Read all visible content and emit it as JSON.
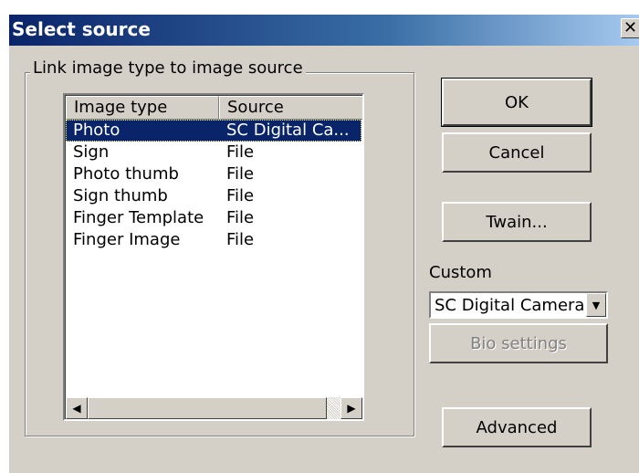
{
  "window": {
    "title": "Select source",
    "close_symbol": "✕"
  },
  "group": {
    "legend": "Link image type to image source"
  },
  "list": {
    "columns": [
      "Image type",
      "Source"
    ],
    "rows": [
      {
        "type": "Photo",
        "source": "SC Digital Ca...",
        "selected": true
      },
      {
        "type": "Sign",
        "source": "File"
      },
      {
        "type": "Photo thumb",
        "source": "File"
      },
      {
        "type": "Sign thumb",
        "source": "File"
      },
      {
        "type": "Finger Template",
        "source": "File"
      },
      {
        "type": "Finger Image",
        "source": "File"
      }
    ],
    "scroll_left_icon": "◀",
    "scroll_right_icon": "▶"
  },
  "buttons": {
    "ok": "OK",
    "cancel": "Cancel",
    "twain": "Twain...",
    "bio_settings": "Bio settings",
    "advanced": "Advanced"
  },
  "custom": {
    "label": "Custom",
    "selected_value": "SC Digital Camera",
    "dropdown_icon": "▼"
  },
  "colors": {
    "face": "#d4d0c8",
    "selection": "#0a246a",
    "title_gradient_start": "#0a246a",
    "title_gradient_end": "#a6caf0"
  }
}
